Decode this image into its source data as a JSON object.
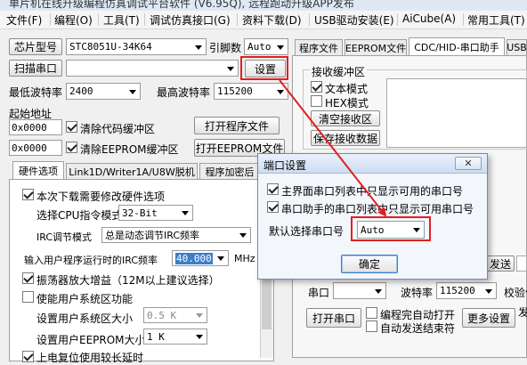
{
  "window": {
    "title": "单片机在线升级编程仿真调试平台软件 (V6.95Q), 远程跑动升级APP发布"
  },
  "menu": [
    {
      "label": "文件(F)"
    },
    {
      "label": "编程(O)"
    },
    {
      "label": "工具(T)"
    },
    {
      "label": "调试仿真接口(G)"
    },
    {
      "label": "资料下载(D)"
    },
    {
      "label": "USB驱动安装(E)"
    },
    {
      "label": "AiCube(A)"
    },
    {
      "label": "常用工具(T)"
    }
  ],
  "left": {
    "chip_model_label": "芯片型号",
    "chip_model_value": "STC8051U-34K64",
    "pin_count_label": "引脚数",
    "pin_count_value": "Auto",
    "scan_port_button": "扫描串口",
    "port_value": "",
    "settings_button": "设置",
    "min_baud_label": "最低波特率",
    "min_baud_value": "2400",
    "max_baud_label": "最高波特率",
    "max_baud_value": "115200",
    "start_addr_label": "起始地址",
    "code_addr": "0x0000",
    "clear_code_label": "清除代码缓冲区",
    "open_program_button": "打开程序文件",
    "eeprom_addr": "0x0000",
    "clear_eeprom_label": "清除EEPROM缓冲区",
    "open_eeprom_button": "打开EEPROM文件",
    "tabs": [
      {
        "label": "硬件选项"
      },
      {
        "label": "Link1D/Writer1A/U8W脱机"
      },
      {
        "label": "程序加密后"
      }
    ],
    "hw": {
      "modify_hw": "本次下载需要修改硬件选项",
      "cpu_mode_label": "选择CPU指令模式",
      "cpu_mode_value": "32-Bit",
      "irc_mode_label": "IRC调节模式",
      "irc_mode_value": "总是动态调节IRC频率",
      "irc_freq_label": "输入用户程序运行时的IRC频率",
      "irc_freq_value": "40.000",
      "irc_unit": "MHz",
      "amp_gain": "振荡器放大增益（12M以上建议选择）",
      "user_sys_area": "使能用户系统区功能",
      "user_sys_size_label": "设置用户系统区大小",
      "user_sys_size_value": "0.5 K",
      "user_eeprom_size_label": "设置用户EEPROM大小",
      "user_eeprom_size_value": "1  K",
      "power_reset": "上电复位使用较长延时"
    }
  },
  "right": {
    "tabs": [
      {
        "label": "程序文件"
      },
      {
        "label": "EEPROM文件"
      },
      {
        "label": "CDC/HID-串口助手"
      },
      {
        "label": "USB"
      }
    ],
    "recv_buffer_label": "接收缓冲区",
    "text_mode": "文本模式",
    "hex_mode": "HEX模式",
    "clear_recv_button": "清空接收区",
    "save_recv_button": "保存接收数据",
    "send_button_partial": "发送",
    "port_label": "串口",
    "port_value": "",
    "baud_label": "波特率",
    "baud_value": "115200",
    "check_label": "校验位",
    "open_port_button": "打开串口",
    "auto_open_after_prog": "编程完自动打开",
    "auto_send_end": "自动发送结束符",
    "more_settings_button": "更多设置",
    "more_partial": "发"
  },
  "dialog": {
    "title": "端口设置",
    "opt1": "主界面串口列表中只显示可用的串口号",
    "opt2": "串口助手的串口列表中只显示可用串口号",
    "default_port_label": "默认选择串口号",
    "default_port_value": "Auto",
    "ok_button": "确定"
  },
  "colors": {
    "annotation_red": "#e02020",
    "dialog_border": "#6a8cb8",
    "ok_focus": "#3c7fc8"
  }
}
